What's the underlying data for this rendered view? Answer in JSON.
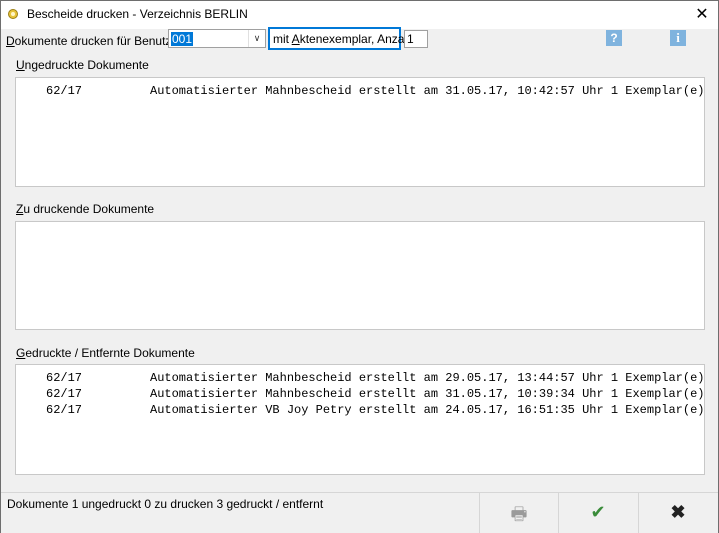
{
  "window": {
    "title": "Bescheide drucken - Verzeichnis BERLIN",
    "close_glyph": "✕"
  },
  "toolbar": {
    "user_label_prefix": "D",
    "user_label_rest": "okumente drucken für Benutzer",
    "user_value": "001",
    "checkbox_label_prefix": "mit ",
    "checkbox_label_accel": "A",
    "checkbox_label_rest": "ktenexemplar, Anzahl",
    "count_value": "1",
    "help_glyph": "?",
    "info_glyph": "i"
  },
  "sections": {
    "unprinted_label_accel": "U",
    "unprinted_label_rest": "ngedruckte Dokumente",
    "to_print_label_accel": "Z",
    "to_print_label_rest": "u druckende Dokumente",
    "printed_label_accel": "G",
    "printed_label_rest": "edruckte / Entfernte Dokumente"
  },
  "lists": {
    "unprinted": [
      {
        "num": "62/17",
        "text": "Automatisierter Mahnbescheid erstellt am 31.05.17, 10:42:57 Uhr 1 Exemplar(e)"
      }
    ],
    "to_print": [],
    "printed": [
      {
        "num": "62/17",
        "text": "Automatisierter Mahnbescheid erstellt am 29.05.17, 13:44:57 Uhr 1 Exemplar(e)"
      },
      {
        "num": "62/17",
        "text": "Automatisierter Mahnbescheid erstellt am 31.05.17, 10:39:34 Uhr 1 Exemplar(e)"
      },
      {
        "num": "62/17",
        "text": "Automatisierter VB Joy Petry erstellt am 24.05.17, 16:51:35 Uhr 1 Exemplar(e)"
      }
    ]
  },
  "status": {
    "text": "Dokumente 1 ungedruckt  0 zu drucken  3 gedruckt / entfernt"
  },
  "buttons": {
    "print_icon": "🖶",
    "ok_icon": "✔",
    "cancel_icon": "✖"
  }
}
